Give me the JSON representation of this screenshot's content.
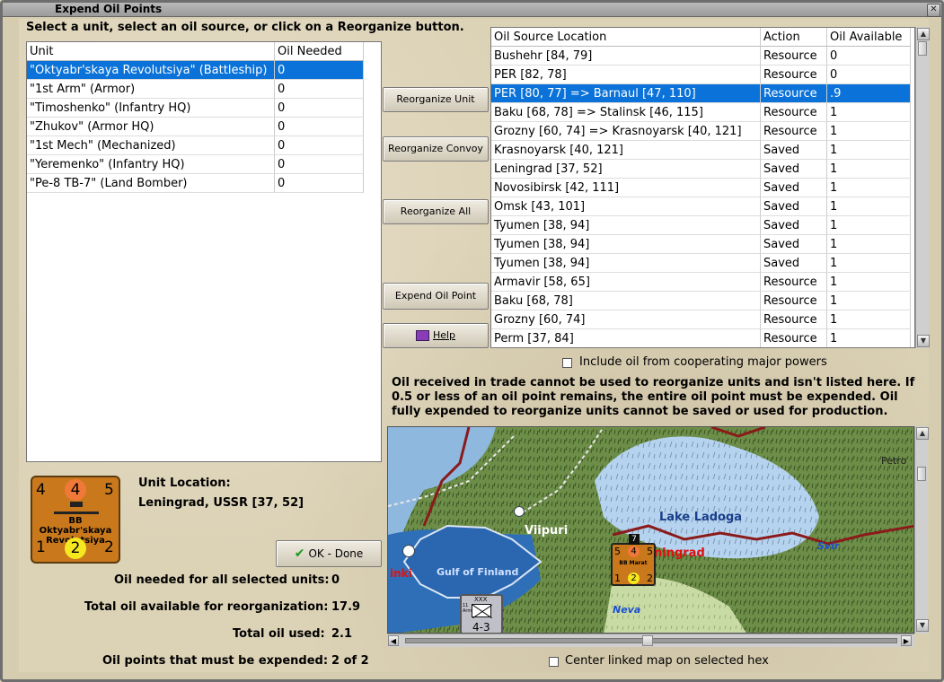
{
  "window": {
    "title": "Expend Oil Points"
  },
  "instructions": "Select a unit, select an oil source, or click on a Reorganize button.",
  "units_table": {
    "headers": [
      "Unit",
      "Oil Needed"
    ],
    "rows": [
      {
        "unit": "\"Oktyabr'skaya Revolutsiya\" (Battleship)",
        "oil": "0",
        "selected": true
      },
      {
        "unit": "\"1st Arm\" (Armor)",
        "oil": "0"
      },
      {
        "unit": "\"Timoshenko\" (Infantry HQ)",
        "oil": "0"
      },
      {
        "unit": "\"Zhukov\" (Armor HQ)",
        "oil": "0"
      },
      {
        "unit": "\"1st Mech\" (Mechanized)",
        "oil": "0"
      },
      {
        "unit": "\"Yeremenko\" (Infantry HQ)",
        "oil": "0"
      },
      {
        "unit": "\"Pe-8 TB-7\" (Land Bomber)",
        "oil": "0"
      }
    ]
  },
  "buttons": {
    "reorganize_unit": "Reorganize Unit",
    "reorganize_convoy": "Reorganize Convoy",
    "reorganize_all": "Reorganize All",
    "expend_oil_point": "Expend Oil Point",
    "help": "Help",
    "ok_done": "OK - Done"
  },
  "oil_table": {
    "headers": [
      "Oil Source Location",
      "Action",
      "Oil Available"
    ],
    "rows": [
      {
        "loc": "Bushehr [84, 79]",
        "action": "Resource",
        "avail": "0"
      },
      {
        "loc": "PER [82, 78]",
        "action": "Resource",
        "avail": "0"
      },
      {
        "loc": "PER [80, 77] => Barnaul [47, 110]",
        "action": "Resource",
        "avail": ".9",
        "selected": true
      },
      {
        "loc": "Baku [68, 78] => Stalinsk [46, 115]",
        "action": "Resource",
        "avail": "1"
      },
      {
        "loc": "Grozny [60, 74] => Krasnoyarsk [40, 121]",
        "action": "Resource",
        "avail": "1"
      },
      {
        "loc": "Krasnoyarsk [40, 121]",
        "action": "Saved",
        "avail": "1"
      },
      {
        "loc": "Leningrad [37, 52]",
        "action": "Saved",
        "avail": "1"
      },
      {
        "loc": "Novosibirsk [42, 111]",
        "action": "Saved",
        "avail": "1"
      },
      {
        "loc": "Omsk [43, 101]",
        "action": "Saved",
        "avail": "1"
      },
      {
        "loc": "Tyumen [38, 94]",
        "action": "Saved",
        "avail": "1"
      },
      {
        "loc": "Tyumen [38, 94]",
        "action": "Saved",
        "avail": "1"
      },
      {
        "loc": "Tyumen [38, 94]",
        "action": "Saved",
        "avail": "1"
      },
      {
        "loc": "Armavir [58, 65]",
        "action": "Resource",
        "avail": "1"
      },
      {
        "loc": "Baku [68, 78]",
        "action": "Resource",
        "avail": "1"
      },
      {
        "loc": "Grozny [60, 74]",
        "action": "Resource",
        "avail": "1"
      },
      {
        "loc": "Perm [37, 84]",
        "action": "Resource",
        "avail": "1"
      }
    ]
  },
  "include_coop_label": "Include oil from cooperating major powers",
  "note": [
    "Oil received in trade cannot be used to reorganize units and isn't listed here.  If",
    "0.5 or less of an oil point remains, the entire oil point must be expended.   Oil",
    "fully expended to reorganize units cannot be saved or used for production."
  ],
  "unit_counter": {
    "top_left": "4",
    "top_mid": "4",
    "top_right": "5",
    "name1": "BB Oktyabr'skaya",
    "name2": "Revolutsiya",
    "bot_left": "1",
    "bot_mid": "2",
    "bot_right": "2"
  },
  "unit_location": {
    "label": "Unit Location:",
    "value": "Leningrad, USSR [37, 52]"
  },
  "stats": {
    "oil_needed_label": "Oil needed for all selected units:",
    "oil_needed_value": "0",
    "total_available_label": "Total oil available for reorganization:",
    "total_available_value": "17.9",
    "total_used_label": "Total oil used:",
    "total_used_value": "2.1",
    "must_expend_label": "Oil points that must be expended:",
    "must_expend_value": "2 of 2"
  },
  "map": {
    "labels": {
      "lake": "Lake Ladoga",
      "gulf": "Gulf of Finland",
      "viipuri": "Viipuri",
      "leningrad": "ningrad",
      "helsinki": "inki",
      "svir": "Svir",
      "neva": "Neva",
      "petro": "Petro"
    },
    "map_counter": {
      "top": "7",
      "a": "5",
      "b": "4",
      "c": "5",
      "name": "BB Marat",
      "d": "1",
      "e": "2",
      "f": "2"
    },
    "army_counter": {
      "top": "XXX",
      "side": "11 Arm",
      "value": "4-3"
    }
  },
  "center_map_label": "Center linked map on selected hex",
  "colors": {
    "selection": "#0a72d8",
    "counter": "#c9791c",
    "water": "#3a79c4",
    "red_label": "#e01010"
  }
}
